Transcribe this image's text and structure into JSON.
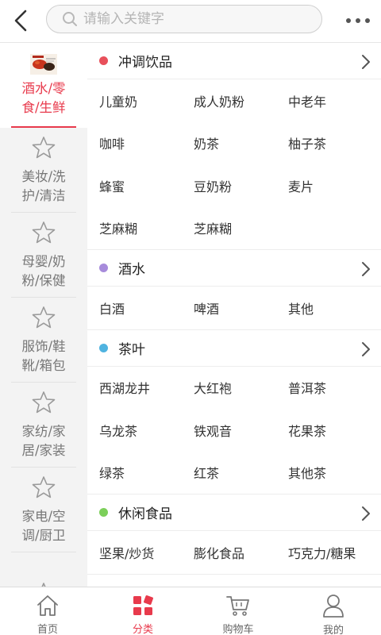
{
  "header": {
    "search_placeholder": "请输入关键字"
  },
  "sidebar": {
    "items": [
      {
        "label": "酒水/零\n食/生鲜",
        "active": true,
        "icon": "food-thumbnail"
      },
      {
        "label": "美妆/洗\n护/清洁",
        "active": false,
        "icon": "star-icon"
      },
      {
        "label": "母婴/奶\n粉/保健",
        "active": false,
        "icon": "star-icon"
      },
      {
        "label": "服饰/鞋\n靴/箱包",
        "active": false,
        "icon": "star-icon"
      },
      {
        "label": "家纺/家\n居/家装",
        "active": false,
        "icon": "star-icon"
      },
      {
        "label": "家电/空\n调/厨卫",
        "active": false,
        "icon": "star-icon"
      },
      {
        "label": "",
        "active": false,
        "icon": "star-icon"
      }
    ]
  },
  "sections": [
    {
      "title": "冲调饮品",
      "dot_color": "#e8505b",
      "items": [
        "儿童奶",
        "成人奶粉",
        "中老年",
        "咖啡",
        "奶茶",
        "柚子茶",
        "蜂蜜",
        "豆奶粉",
        "麦片",
        "芝麻糊",
        "芝麻糊"
      ]
    },
    {
      "title": "酒水",
      "dot_color": "#a78bdb",
      "items": [
        "白酒",
        "啤酒",
        "其他"
      ]
    },
    {
      "title": "茶叶",
      "dot_color": "#4fb3e0",
      "items": [
        "西湖龙井",
        "大红袍",
        "普洱茶",
        "乌龙茶",
        "铁观音",
        "花果茶",
        "绿茶",
        "红茶",
        "其他茶"
      ]
    },
    {
      "title": "休闲食品",
      "dot_color": "#7ccf5a",
      "items": [
        "坚果/炒货",
        "膨化食品",
        "巧克力/糖果"
      ]
    }
  ],
  "bottom_nav": {
    "tabs": [
      {
        "label": "首页",
        "icon": "home-icon",
        "active": false
      },
      {
        "label": "分类",
        "icon": "category-icon",
        "active": true
      },
      {
        "label": "购物车",
        "icon": "cart-icon",
        "active": false
      },
      {
        "label": "我的",
        "icon": "user-icon",
        "active": false
      }
    ]
  },
  "colors": {
    "accent": "#e83a4c",
    "sidebar_bg": "#f3f3f3",
    "muted_text": "#777777"
  }
}
